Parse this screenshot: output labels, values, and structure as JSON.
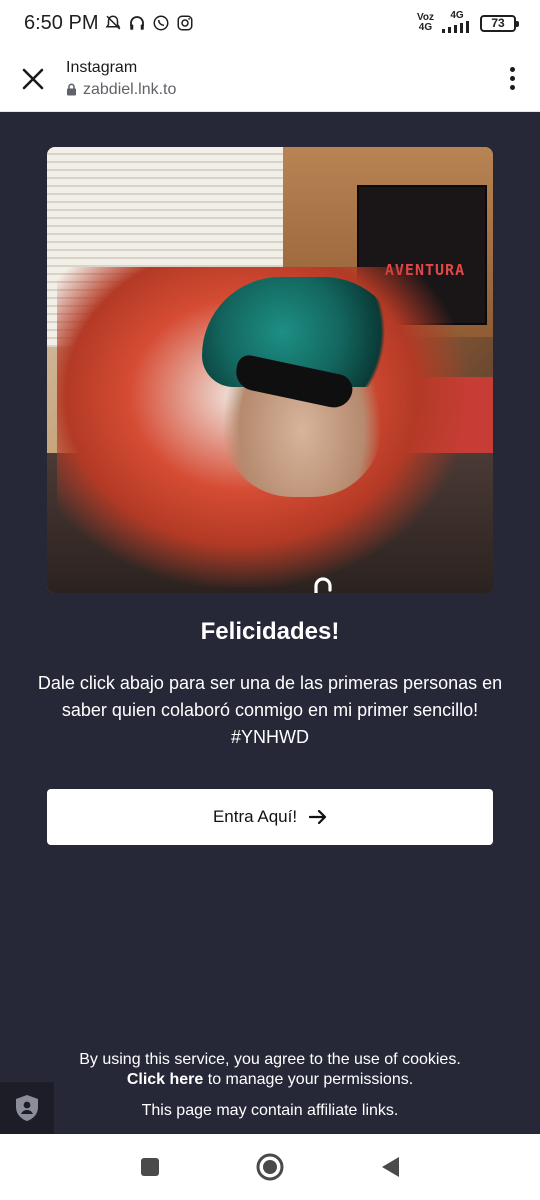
{
  "status_bar": {
    "time": "6:50 PM",
    "voz_label": "Voz",
    "net_label_left": "4G",
    "net_label_right": "4G",
    "battery": "73"
  },
  "browser": {
    "title": "Instagram",
    "url": "zabdiel.lnk.to"
  },
  "artwork": {
    "poster_text": "AVENTURA"
  },
  "content": {
    "title": "Felicidades!",
    "description": "Dale click abajo para ser una de las primeras personas en saber quien colaboró conmigo en mi primer sencillo! #YNHWD",
    "cta_label": "Entra Aquí!"
  },
  "footer": {
    "cookie_text": "By using this service, you agree to the use of cookies.",
    "click_here": "Click here",
    "manage_text": " to manage your permissions.",
    "affiliate_text": "This page may contain affiliate links."
  },
  "colors": {
    "page_background": "#262838",
    "button_background": "#ffffff"
  },
  "icons": {
    "close": "close-icon",
    "menu": "more-vert-icon",
    "lock": "lock-icon",
    "unlock": "unlock-icon",
    "arrow": "arrow-right-icon",
    "shield": "shield-icon",
    "nav_recents": "square-icon",
    "nav_home": "circle-icon",
    "nav_back": "triangle-back-icon"
  }
}
